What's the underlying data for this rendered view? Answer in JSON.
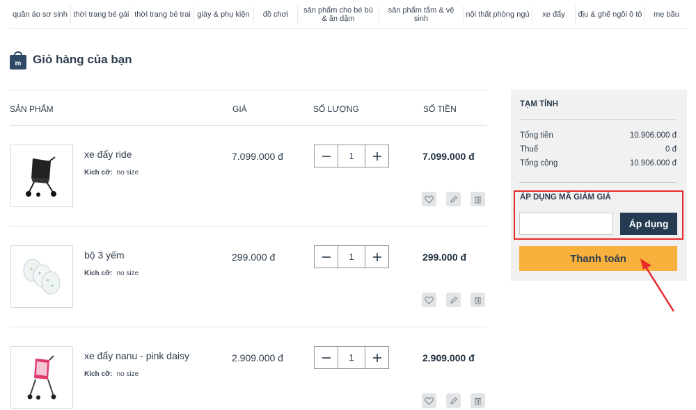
{
  "nav": {
    "items": [
      "quần áo sơ sinh",
      "thời trang bé gái",
      "thời trang bé trai",
      "giày & phụ kiện",
      "đồ chơi",
      "sản phẩm cho bé bú & ăn dặm",
      "sản phẩm tắm & vệ sinh",
      "nội thất phòng ngủ",
      "xe đẩy",
      "địu & ghế ngồi ô tô",
      "mẹ bầu"
    ]
  },
  "page": {
    "title": "Giỏ hàng của bạn"
  },
  "cart": {
    "columns": {
      "product": "SẢN PHẨM",
      "price": "GIÁ",
      "quantity": "SỐ LƯỢNG",
      "amount": "SỐ TIỀN"
    },
    "size_label": "Kích cỡ:",
    "items": [
      {
        "name": "xe đẩy ride",
        "size": "no size",
        "price": "7.099.000 đ",
        "quantity": "1",
        "amount": "7.099.000 đ"
      },
      {
        "name": "bộ 3 yếm",
        "size": "no size",
        "price": "299.000 đ",
        "quantity": "1",
        "amount": "299.000 đ"
      },
      {
        "name": "xe đẩy nanu - pink daisy",
        "size": "no size",
        "price": "2.909.000 đ",
        "quantity": "1",
        "amount": "2.909.000 đ"
      }
    ]
  },
  "summary": {
    "title": "TẠM TÍNH",
    "subtotal_label": "Tổng tiền",
    "subtotal_value": "10.906.000 đ",
    "tax_label": "Thuế",
    "tax_value": "0 đ",
    "total_label": "Tổng cộng",
    "total_value": "10.906.000 đ",
    "promo_title": "ÁP DỤNG MÃ GIẢM GIÁ",
    "promo_value": "",
    "apply_label": "Áp dụng",
    "checkout_label": "Thanh toán"
  },
  "colors": {
    "navy": "#253b52",
    "checkout": "#f7b13c",
    "highlight": "#e8292a"
  }
}
